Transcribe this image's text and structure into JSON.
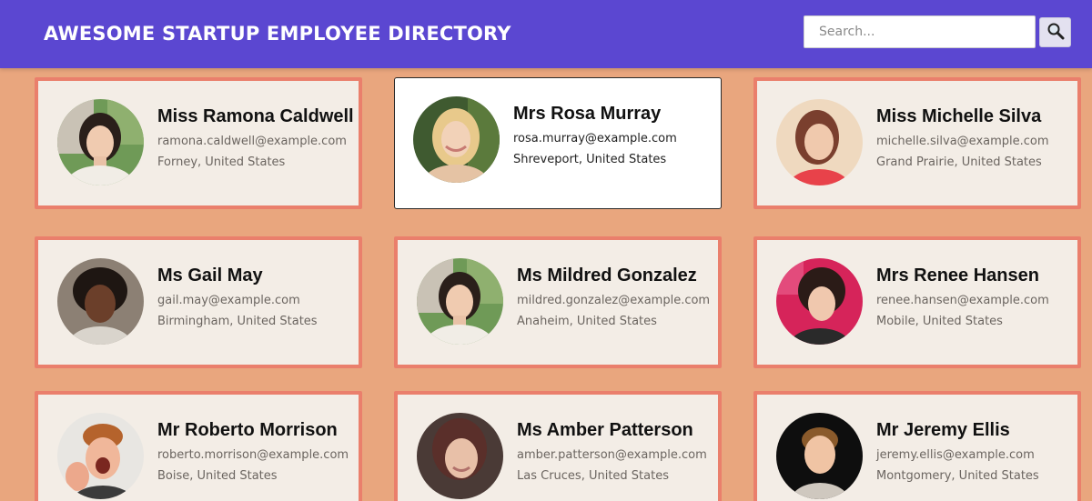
{
  "header": {
    "title": "AWESOME STARTUP EMPLOYEE DIRECTORY",
    "search_placeholder": "Search..."
  },
  "icons": {
    "search": "magnifying-glass-icon"
  },
  "colors": {
    "page_bg": "#e9a67e",
    "header_bg": "#5b47d1",
    "card_bg": "#f3ede6",
    "card_border": "#ea7f6c",
    "selected_card_bg": "#ffffff"
  },
  "employees": [
    {
      "name": "Miss Ramona Caldwell",
      "email": "ramona.caldwell@example.com",
      "location": "Forney, United States"
    },
    {
      "name": "Mrs Rosa Murray",
      "email": "rosa.murray@example.com",
      "location": "Shreveport, United States",
      "selected": true
    },
    {
      "name": "Miss Michelle Silva",
      "email": "michelle.silva@example.com",
      "location": "Grand Prairie, United States"
    },
    {
      "name": "Ms Gail May",
      "email": "gail.may@example.com",
      "location": "Birmingham, United States"
    },
    {
      "name": "Ms Mildred Gonzalez",
      "email": "mildred.gonzalez@example.com",
      "location": "Anaheim, United States"
    },
    {
      "name": "Mrs Renee Hansen",
      "email": "renee.hansen@example.com",
      "location": "Mobile, United States"
    },
    {
      "name": "Mr Roberto Morrison",
      "email": "roberto.morrison@example.com",
      "location": "Boise, United States"
    },
    {
      "name": "Ms Amber Patterson",
      "email": "amber.patterson@example.com",
      "location": "Las Cruces, United States"
    },
    {
      "name": "Mr Jeremy Ellis",
      "email": "jeremy.ellis@example.com",
      "location": "Montgomery, United States"
    }
  ]
}
